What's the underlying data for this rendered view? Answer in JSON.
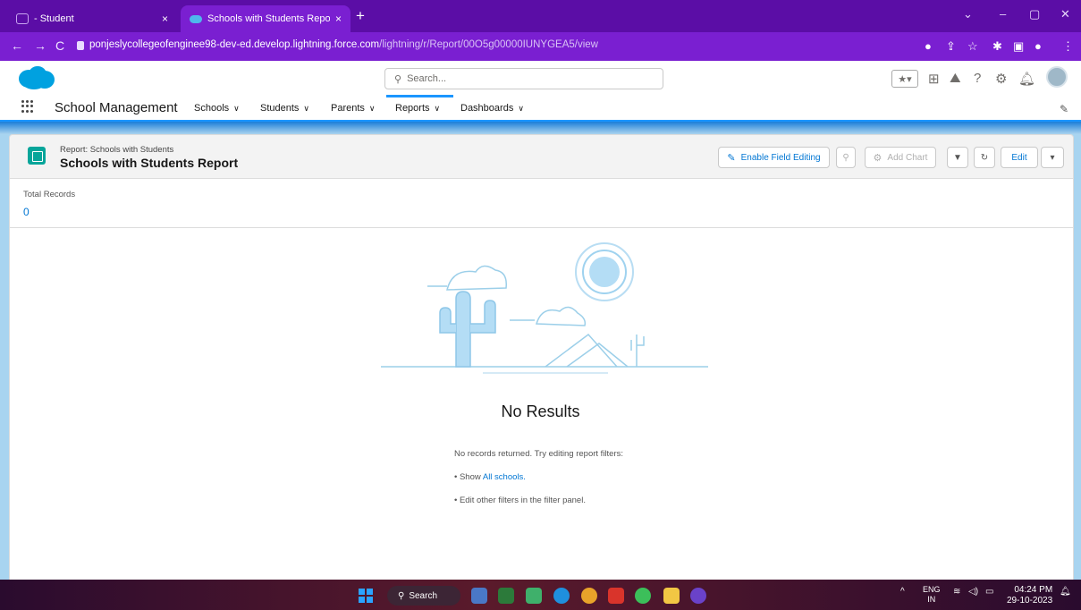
{
  "browser": {
    "tabs": [
      {
        "label": "- Student",
        "close": "×"
      },
      {
        "label": "Schools with Students Report | S",
        "close": "×"
      }
    ],
    "new_tab": "+",
    "window_controls": {
      "minimize": "–",
      "restore": "▢",
      "close": "✕",
      "dropdown": "⌄"
    },
    "url_host": "ponjeslycollegeofenginee98-dev-ed.develop.lightning.force.com",
    "url_path": "/lightning/r/Report/00O5g00000IUNYGEA5/view"
  },
  "header": {
    "search_placeholder": "Search...",
    "icons": [
      "favorites-icon",
      "add-icon",
      "trailhead-icon",
      "help-icon",
      "setup-icon",
      "notifications-icon"
    ]
  },
  "app_nav": {
    "app_name": "School Management",
    "items": [
      {
        "label": "Schools"
      },
      {
        "label": "Students"
      },
      {
        "label": "Parents"
      },
      {
        "label": "Reports"
      },
      {
        "label": "Dashboards"
      }
    ],
    "active": "Reports"
  },
  "report": {
    "eyebrow": "Report: Schools with Students",
    "title": "Schools with Students Report",
    "buttons": {
      "enable_field_editing": "Enable Field Editing",
      "add_chart": "Add Chart",
      "edit": "Edit"
    },
    "total_records_label": "Total Records",
    "total_records_value": "0"
  },
  "empty_state": {
    "title": "No Results",
    "message": "No records returned. Try editing report filters:",
    "hint1_prefix": "• Show ",
    "hint1_link": "All schools.",
    "hint2": "• Edit other filters in the filter panel."
  },
  "taskbar": {
    "search_label": "Search",
    "lang_top": "ENG",
    "lang_bottom": "IN",
    "time": "04:24 PM",
    "date": "29-10-2023"
  }
}
